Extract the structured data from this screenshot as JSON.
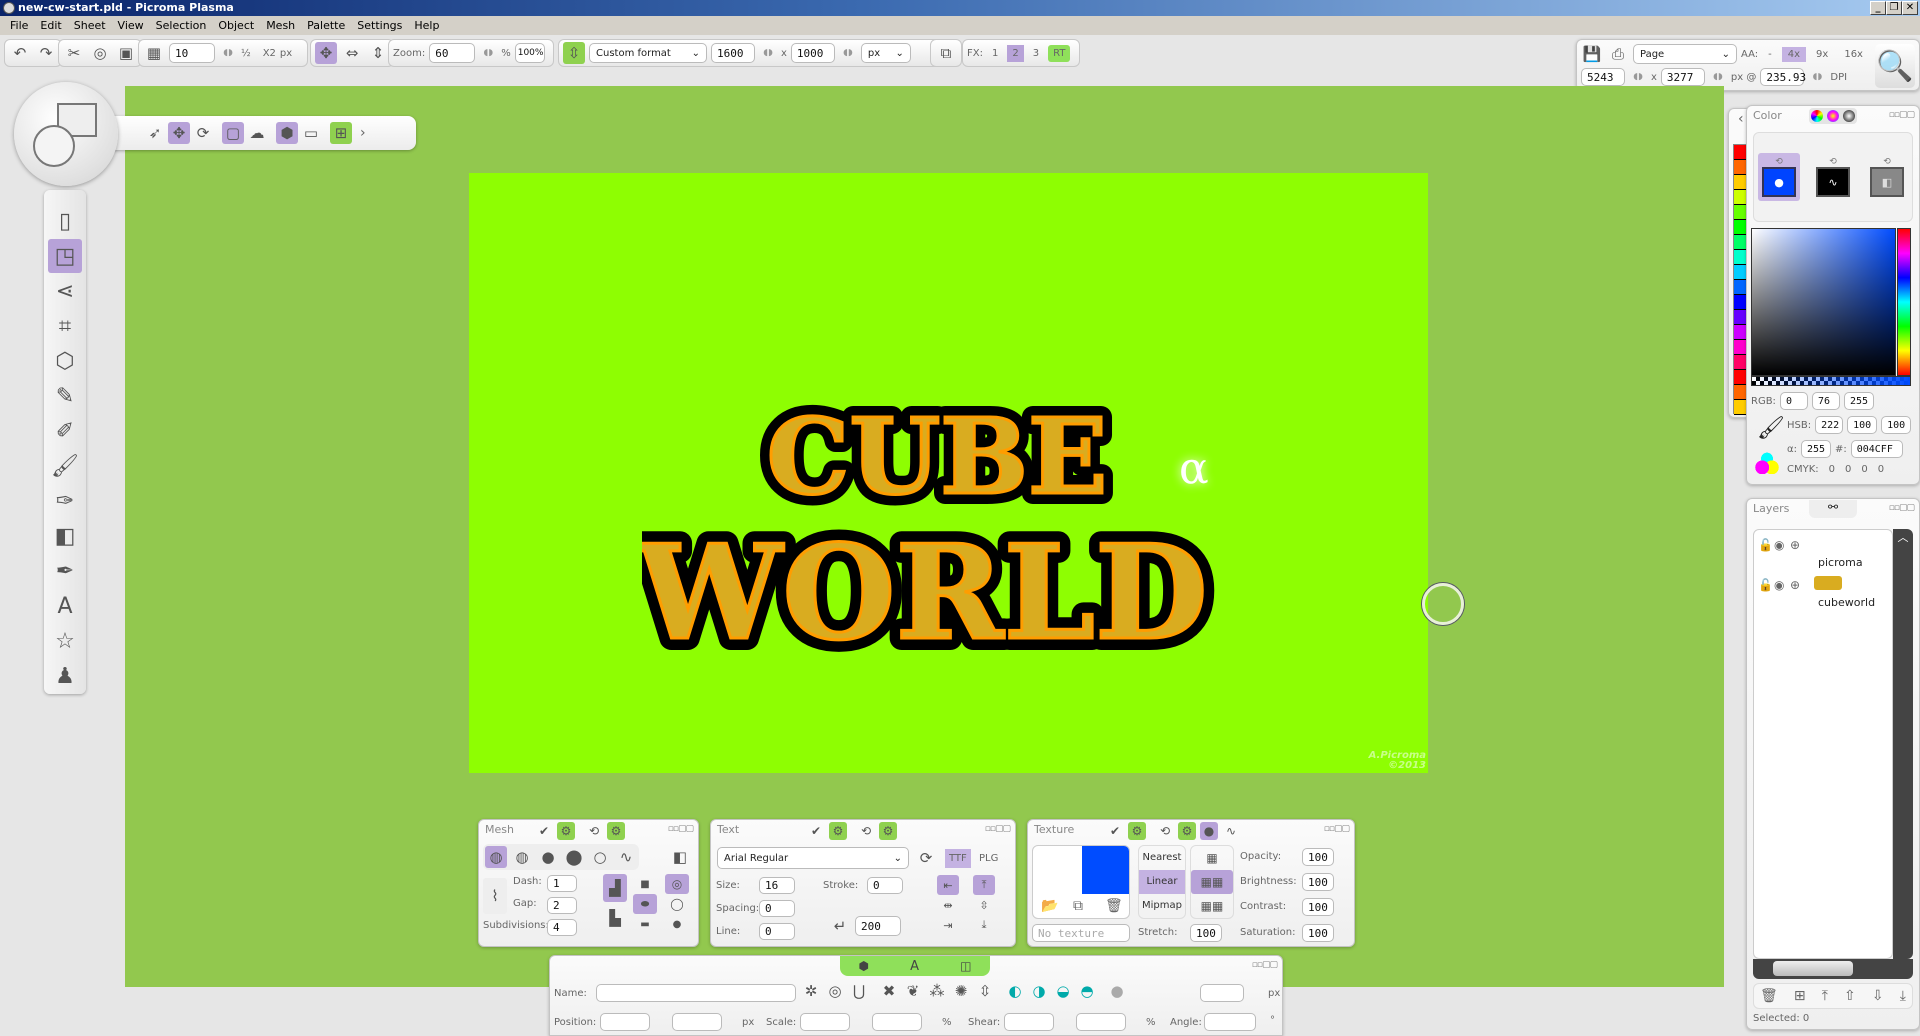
{
  "window": {
    "title": "new-cw-start.pld - Picroma Plasma",
    "controls": [
      "_",
      "❐",
      "✕"
    ]
  },
  "menu": [
    "File",
    "Edit",
    "Sheet",
    "View",
    "Selection",
    "Object",
    "Mesh",
    "Palette",
    "Settings",
    "Help"
  ],
  "toolbar": {
    "grid_size": "10",
    "half_label": "½",
    "double_label": "X2",
    "grid_unit": "px",
    "zoom_label": "Zoom:",
    "zoom_value": "60",
    "zoom_unit": "%",
    "zoom_reset": "100%",
    "format": "Custom format",
    "width": "1600",
    "x_sep": "x",
    "height": "1000",
    "unit": "px",
    "fx_label": "FX:",
    "fx_options": [
      "1",
      "2",
      "3"
    ],
    "fx_selected": "2",
    "rt_label": "RT"
  },
  "export": {
    "mode": "Page",
    "aa_label": "AA:",
    "aa_options": [
      "-",
      "4x",
      "9x",
      "16x"
    ],
    "aa_selected": "4x",
    "width": "5243",
    "x_sep": "x",
    "height": "3277",
    "px_at": "px @",
    "dpi": "235.93",
    "dpi_label": "DPI"
  },
  "document": {
    "logo_line1": "CUBE",
    "logo_line2": "WORLD",
    "alpha": "α",
    "watermark_line1": "A.Picroma",
    "watermark_line2": "©2013",
    "background": "#8efe02"
  },
  "tools": [
    "page-tool",
    "shape-tool",
    "node-tool",
    "mesh-edit-tool",
    "grid-mesh-tool",
    "pen-polygon-tool",
    "pen-edit-tool",
    "brush-tool",
    "smudge-brush-tool",
    "extrude-tool",
    "stroke-pen-tool",
    "text-tool",
    "star-tool",
    "stamp-tool"
  ],
  "color_panel": {
    "title": "Color",
    "rgb_label": "RGB:",
    "r": "0",
    "g": "76",
    "b": "255",
    "hsb_label": "HSB:",
    "h": "222",
    "s": "100",
    "br": "100",
    "alpha_label": "α:",
    "alpha": "255",
    "hex_label": "#:",
    "hex": "004CFF",
    "cmyk_label": "CMYK:",
    "cmyk": [
      "0",
      "0",
      "0",
      "0"
    ],
    "current_color": "#004cff"
  },
  "layers_panel": {
    "title": "Layers",
    "layers": [
      {
        "name": "picroma"
      },
      {
        "name": "cubeworld"
      }
    ],
    "selected_label": "Selected: 0"
  },
  "mesh_panel": {
    "title": "Mesh",
    "dash_label": "Dash:",
    "dash": "1",
    "gap_label": "Gap:",
    "gap": "2",
    "subdiv_label": "Subdivisions:",
    "subdiv": "4"
  },
  "text_panel": {
    "title": "Text",
    "font": "Arial Regular",
    "ttf": "TTF",
    "plg": "PLG",
    "size_label": "Size:",
    "size": "16",
    "stroke_label": "Stroke:",
    "stroke": "0",
    "spacing_label": "Spacing:",
    "spacing": "0",
    "line_label": "Line:",
    "line": "0",
    "wrap": "200"
  },
  "texture_panel": {
    "title": "Texture",
    "filters": [
      "Nearest",
      "Linear",
      "Mipmap"
    ],
    "filter_selected": "Linear",
    "no_texture": "No texture",
    "stretch_label": "Stretch:",
    "stretch": "100",
    "opacity_label": "Opacity:",
    "opacity": "100",
    "brightness_label": "Brightness:",
    "brightness": "100",
    "contrast_label": "Contrast:",
    "contrast": "100",
    "saturation_label": "Saturation:",
    "saturation": "100"
  },
  "object_bar": {
    "name_label": "Name:",
    "name": "",
    "position_label": "Position:",
    "px": "px",
    "scale_label": "Scale:",
    "pct": "%",
    "shear_label": "Shear:",
    "angle_label": "Angle:",
    "deg": "°"
  }
}
